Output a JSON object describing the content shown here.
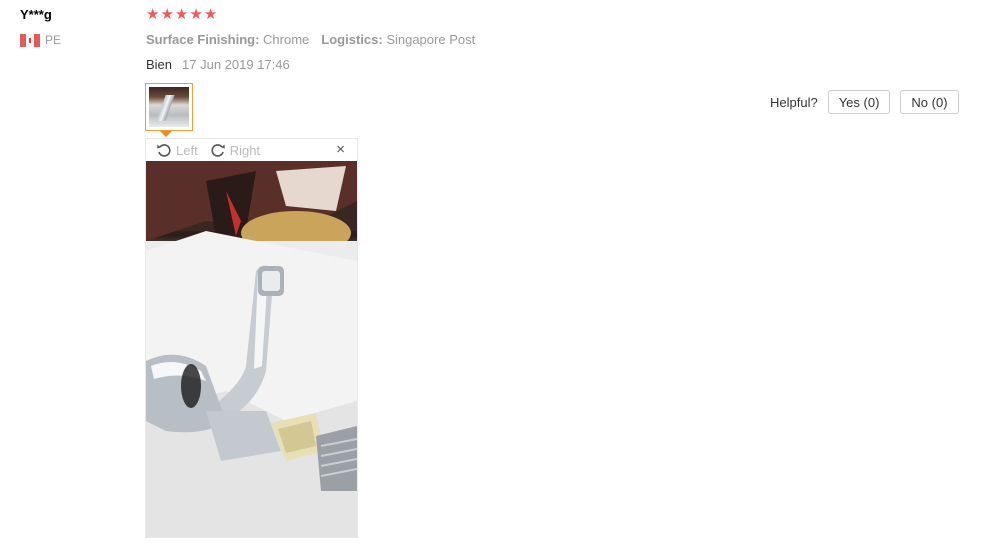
{
  "user": {
    "name": "Y***g",
    "country": "PE"
  },
  "rating": {
    "stars": 5,
    "max": 5,
    "color": "#f05a5a"
  },
  "attributes": [
    {
      "key": "Surface Finishing:",
      "value": "Chrome"
    },
    {
      "key": "Logistics:",
      "value": "Singapore Post"
    }
  ],
  "review": {
    "text": "Bien",
    "date": "17 Jun 2019 17:46"
  },
  "viewer": {
    "rotate_left_label": "Left",
    "rotate_right_label": "Right",
    "close_glyph": "×"
  },
  "helpful": {
    "label": "Helpful?",
    "yes_label": "Yes (0)",
    "no_label": "No (0)"
  },
  "colors": {
    "thumb_border": "#f0a030",
    "star": "#f05a5a"
  }
}
